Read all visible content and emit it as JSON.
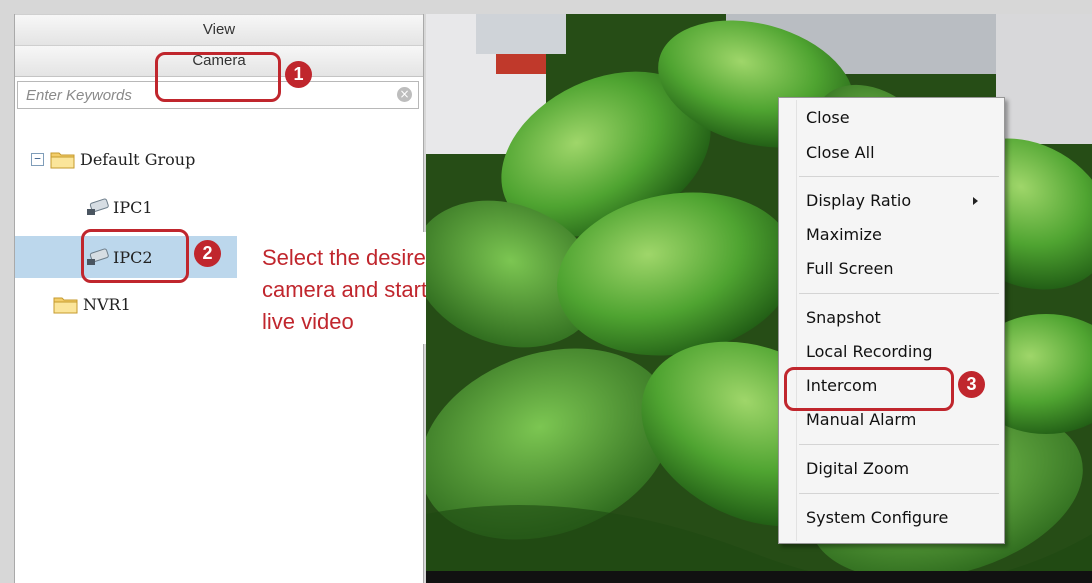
{
  "sidebar": {
    "tab_view": "View",
    "tab_camera": "Camera",
    "search": {
      "placeholder": "Enter Keywords",
      "value": ""
    },
    "tree": {
      "group": "Default Group",
      "cameras": [
        "IPC1",
        "IPC2"
      ],
      "nvr": "NVR1"
    }
  },
  "annotations": {
    "badge1": "1",
    "badge2": "2",
    "badge3": "3",
    "callout_lines": [
      "Select the desired",
      "camera and start",
      "live video"
    ]
  },
  "context_menu": {
    "items": {
      "close": "Close",
      "close_all": "Close All",
      "display_ratio": "Display Ratio",
      "maximize": "Maximize",
      "full_screen": "Full Screen",
      "snapshot": "Snapshot",
      "local_recording": "Local Recording",
      "intercom": "Intercom",
      "manual_alarm": "Manual Alarm",
      "digital_zoom": "Digital Zoom",
      "system_configure": "System Configure"
    }
  },
  "colors": {
    "accent_red": "#c0262d",
    "selection": "#bcd7ec"
  },
  "icons": [
    "folder-icon",
    "camera-icon",
    "clear-icon",
    "chevron-right-icon"
  ]
}
